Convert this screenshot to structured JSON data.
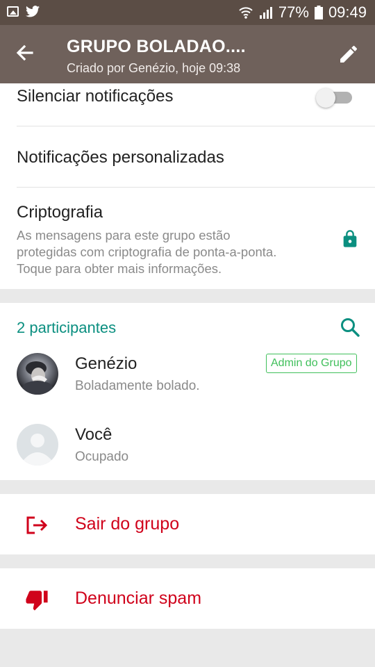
{
  "status_bar": {
    "battery": "77%",
    "time": "09:49",
    "icons": [
      "image-icon",
      "twitter-icon",
      "wifi-icon",
      "signal-icon",
      "battery-icon"
    ]
  },
  "app_bar": {
    "title": "GRUPO BOLADAO....",
    "subtitle": "Criado por Genézio, hoje 09:38",
    "icons": [
      "back-arrow-icon",
      "edit-pencil-icon"
    ]
  },
  "settings": {
    "mute_label": "Silenciar notificações",
    "mute_enabled": false,
    "custom_notifications_label": "Notificações personalizadas",
    "encryption_title": "Criptografia",
    "encryption_lines": [
      "As mensagens para este grupo estão",
      "protegidas com criptografia de ponta-a-ponta.",
      "Toque para obter mais informações."
    ]
  },
  "participants": {
    "title": "2 participantes",
    "list": [
      {
        "name": "Genézio",
        "status": "Boladamente bolado.",
        "badge": "Admin do Grupo"
      },
      {
        "name": "Você",
        "status": "Ocupado"
      }
    ]
  },
  "actions": {
    "exit_label": "Sair do grupo",
    "spam_label": "Denunciar spam"
  },
  "colors": {
    "status_bar": "#5b4d45",
    "app_bar": "#6f615b",
    "accent_teal": "#0b8f80",
    "danger_red": "#d0021b",
    "admin_green": "#3fbf5a"
  }
}
